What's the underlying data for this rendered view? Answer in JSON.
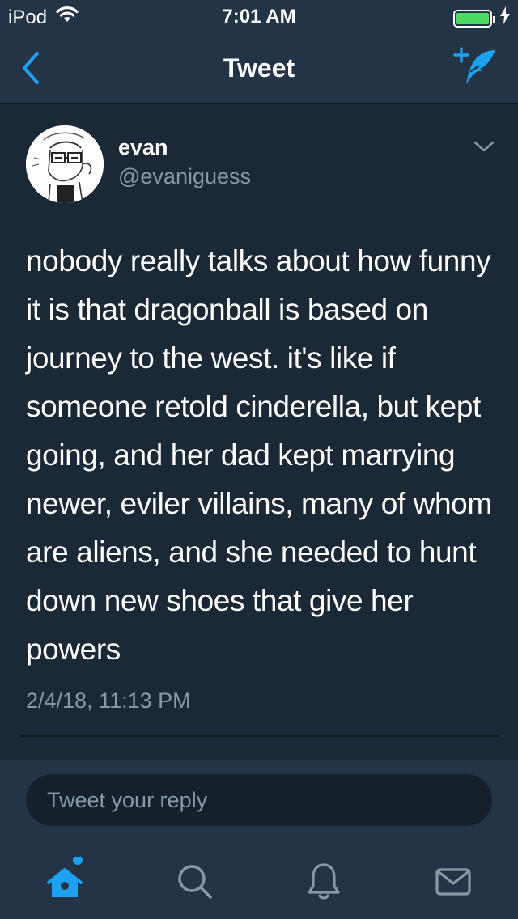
{
  "status_bar": {
    "carrier": "iPod",
    "time": "7:01 AM",
    "battery_level": 1.0,
    "battery_color": "#4cd964",
    "icons": [
      "wifi-icon",
      "battery-icon",
      "charging-bolt-icon"
    ]
  },
  "nav": {
    "title": "Tweet",
    "back_icon": "chevron-left-icon",
    "compose_icon": "compose-tweet-icon",
    "accent_color": "#1da1f2"
  },
  "tweet": {
    "author_name": "evan",
    "author_handle": "@evaniguess",
    "text": "nobody really talks about how funny it is that dragonball is based on journey to the west. it's like if someone retold cinderella, but kept going, and her dad kept marrying newer, eviler villains, many of whom are aliens, and she needed to hunt down new shoes that give her powers",
    "timestamp": "2/4/18, 11:13 PM",
    "menu_icon": "chevron-down-icon"
  },
  "reply": {
    "placeholder": "Tweet your reply"
  },
  "tabs": [
    {
      "name": "home",
      "icon": "home-icon",
      "active": true,
      "has_notification_dot": true
    },
    {
      "name": "search",
      "icon": "search-icon",
      "active": false
    },
    {
      "name": "notifications",
      "icon": "bell-icon",
      "active": false
    },
    {
      "name": "messages",
      "icon": "envelope-icon",
      "active": false
    }
  ],
  "colors": {
    "background": "#1b2836",
    "bar": "#243447",
    "secondary_text": "#8899a6",
    "accent": "#1da1f2"
  }
}
